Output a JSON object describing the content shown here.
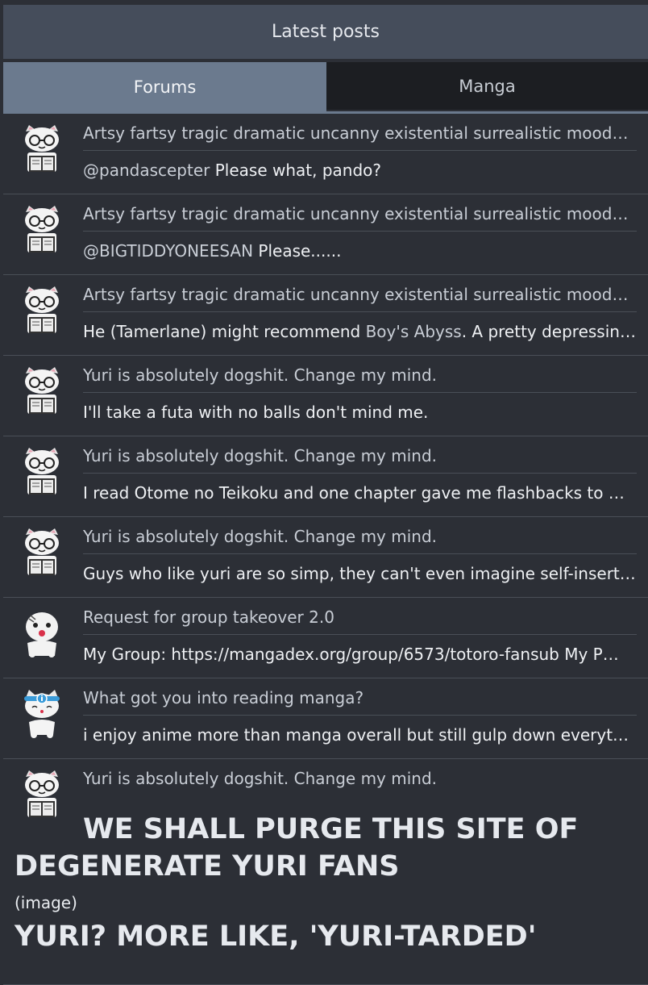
{
  "header": {
    "title": "Latest posts"
  },
  "tabs": [
    {
      "label": "Forums",
      "active": true
    },
    {
      "label": "Manga",
      "active": false
    }
  ],
  "posts": [
    {
      "avatar": "reading-cat-avatar",
      "thread": "Artsy fartsy tragic dramatic uncanny existential surrealistic moody…",
      "mention": "@pandascepter",
      "text": " Please what, pando?"
    },
    {
      "avatar": "reading-cat-avatar",
      "thread": "Artsy fartsy tragic dramatic uncanny existential surrealistic moody…",
      "mention": "@BIGTIDDYONEESAN",
      "text": " Please......"
    },
    {
      "avatar": "reading-cat-avatar",
      "thread": "Artsy fartsy tragic dramatic uncanny existential surrealistic moody…",
      "text_before": "He (Tamerlane) might recommend ",
      "link": "Boy's Abyss",
      "text_after": ". A pretty depressin…"
    },
    {
      "avatar": "reading-cat-avatar",
      "thread": "Yuri is absolutely dogshit. Change my mind.",
      "text": "I'll take a futa with no balls don't mind me."
    },
    {
      "avatar": "reading-cat-avatar",
      "thread": "Yuri is absolutely dogshit. Change my mind.",
      "text": "I read Otome no Teikoku and one chapter gave me flashbacks to …"
    },
    {
      "avatar": "reading-cat-avatar",
      "thread": "Yuri is absolutely dogshit. Change my mind.",
      "text": "Guys who like yuri are so simp, they can't even imagine self-inserti…"
    },
    {
      "avatar": "ghost-cat-avatar",
      "thread": "Request for group takeover 2.0",
      "text": "My Group: https://mangadex.org/group/6573/totoro-fansub My P…"
    },
    {
      "avatar": "info-cat-avatar",
      "thread": "What got you into reading manga?",
      "text": "i enjoy anime more than manga overall but still gulp down everyth…"
    }
  ],
  "last_post": {
    "avatar": "reading-cat-avatar",
    "thread": "Yuri is absolutely dogshit. Change my mind.",
    "headline": "WE SHALL PURGE THIS SITE OF DEGENERATE YURI FANS",
    "image_note": "(image)",
    "headline2": "YURI? MORE LIKE, 'YURI-TARDED'"
  }
}
